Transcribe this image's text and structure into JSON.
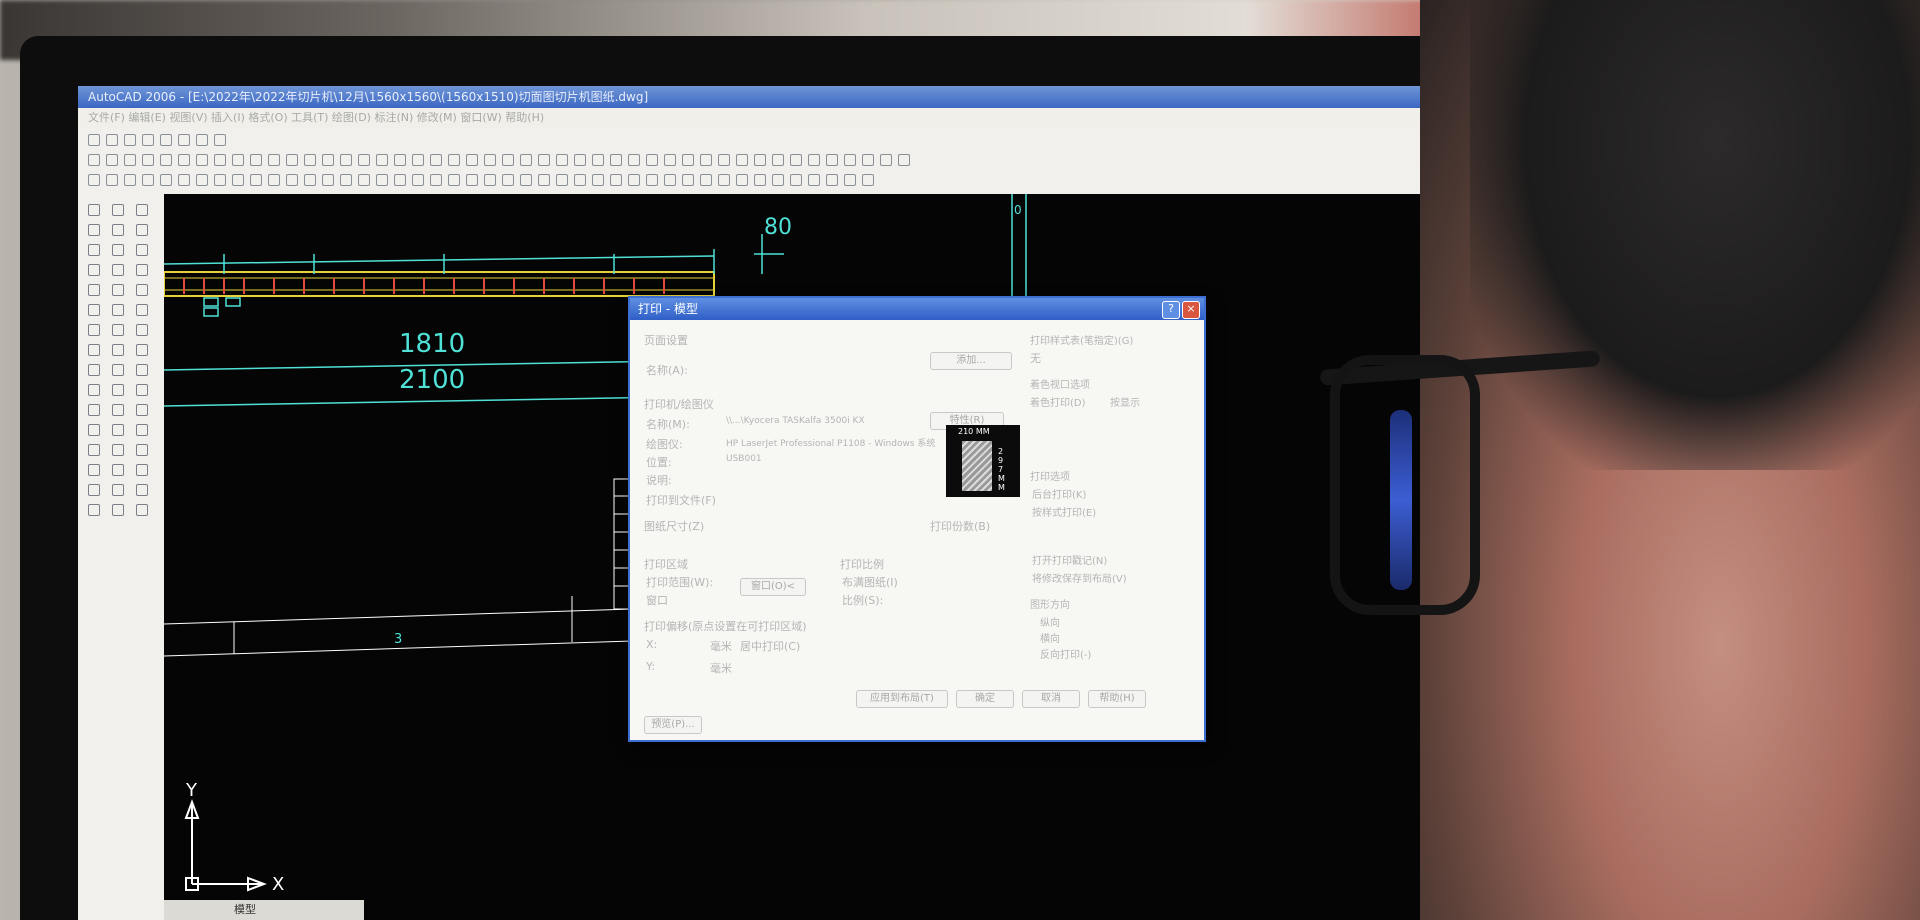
{
  "app": {
    "title": "AutoCAD 2006 - [E:\\2022年\\2022年切片机\\12月\\1560x1560\\(1560x1510)切面图切片机图纸.dwg]",
    "menu": "文件(F)  编辑(E)  视图(V)  插入(I)  格式(O)  工具(T)  绘图(D)  标注(N)  修改(M)  窗口(W)  帮助(H)"
  },
  "drawing": {
    "dims": {
      "top": "80",
      "d1810": "1810",
      "d2100": "2100",
      "part": "3",
      "corner": "0"
    },
    "ucs": {
      "x": "X",
      "y": "Y"
    },
    "tab_model": "模型"
  },
  "dialog": {
    "title": "打印 - 模型",
    "page_setup": "页面设置",
    "name_label": "名称(A):",
    "add_button": "添加...",
    "printer_section": "打印机/绘图仪",
    "printer_name_label": "名称(M):",
    "printer_name_value": "\\\\...\\Kyocera TASKalfa 3500i KX",
    "properties_button": "特性(R)",
    "plotter_label": "绘图仪:",
    "plotter_value": "HP LaserJet Professional P1108 - Windows 系统",
    "where_label": "位置:",
    "where_value": "USB001",
    "description_label": "说明:",
    "plot_to_file": "打印到文件(F)",
    "preview_width": "210 MM",
    "preview_height": "297 MM",
    "paper_size_label": "图纸尺寸(Z)",
    "copies_label": "打印份数(B)",
    "plot_area_label": "打印区域",
    "plot_range_label": "打印范围(W):",
    "plot_range_value": "窗口",
    "window_button": "窗口(O)<",
    "plot_scale_label": "打印比例",
    "fit_paper": "布满图纸(I)",
    "scale_label": "比例(S):",
    "offset_label": "打印偏移(原点设置在可打印区域)",
    "x_label": "X:",
    "y_label": "Y:",
    "unit_mm": "毫米",
    "center_plot": "居中打印(C)",
    "style_table_label": "打印样式表(笔指定)(G)",
    "style_table_value": "无",
    "shaded_viewport_label": "着色视口选项",
    "shade_plot_label": "着色打印(D)",
    "shade_plot_value": "按显示",
    "plot_options_label": "打印选项",
    "plot_in_background": "后台打印(K)",
    "plot_with_styles": "按样式打印(E)",
    "plot_stamp": "打开打印戳记(N)",
    "save_changes": "将修改保存到布局(V)",
    "orientation_label": "图形方向",
    "portrait": "纵向",
    "landscape": "横向",
    "upside_down": "反向打印(-)",
    "preview_button": "预览(P)...",
    "apply_button": "应用到布局(T)",
    "ok_button": "确定",
    "cancel_button": "取消",
    "help_button": "帮助(H)"
  }
}
